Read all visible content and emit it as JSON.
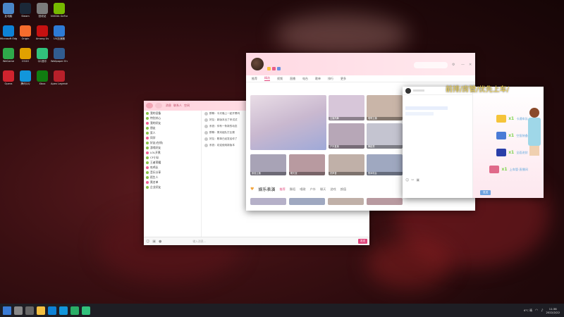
{
  "desktop": {
    "icons": [
      {
        "label": "此电脑",
        "color": "#4a86c8"
      },
      {
        "label": "Steam",
        "color": "#1b2838"
      },
      {
        "label": "回收站",
        "color": "#7b7b7b"
      },
      {
        "label": "NVIDIA GeForce",
        "color": "#76b900"
      },
      {
        "label": "Microsoft Edge",
        "color": "#0d82d6"
      },
      {
        "label": "Origin",
        "color": "#f56c2d"
      },
      {
        "label": "Among Us",
        "color": "#c51111"
      },
      {
        "label": "UU加速器",
        "color": "#2e7bd6"
      },
      {
        "label": "WeGame",
        "color": "#2fa94a"
      },
      {
        "label": "CSGO",
        "color": "#e0a100"
      },
      {
        "label": "QQ音乐",
        "color": "#31c27c"
      },
      {
        "label": "Wallpaper Engine",
        "color": "#315c90"
      },
      {
        "label": "Opera",
        "color": "#d0232e"
      },
      {
        "label": "腾讯QQ",
        "color": "#1296db"
      },
      {
        "label": "Xbox",
        "color": "#107c10"
      },
      {
        "label": "Apex Legends",
        "color": "#b8202a"
      }
    ]
  },
  "qq_window": {
    "title_tabs": [
      "消息",
      "联系人",
      "空间"
    ],
    "groups": [
      "我的设备",
      "特别关心",
      "我的好友",
      "朋友",
      "家人",
      "同学",
      "好友(在线)",
      "游戏好友",
      "LOL开黑",
      "CF小队",
      "王者荣耀",
      "吃鸡队",
      "音乐分享",
      "陌生人",
      "黑名单",
      "企业好友"
    ],
    "messages": [
      "群聊：今天晚上一起开黑吗",
      "好友：新版本出了来试试",
      "系统：你有一条新的动态",
      "群聊：周末组队打比赛",
      "好友：歌单已经发给你了",
      "系统：欢迎使用新版本"
    ],
    "input_placeholder": "输入消息...",
    "send_label": "发送"
  },
  "music_window": {
    "tabs": [
      "推荐",
      "精选",
      "视频",
      "直播",
      "电台",
      "歌单",
      "排行",
      "更多"
    ],
    "active_tab": 1,
    "section_title": "娱乐表演",
    "section_tags": [
      "推荐",
      "舞蹈",
      "唱歌",
      "户外",
      "聊天",
      "游戏",
      "颜值"
    ],
    "cards": [
      "主播热舞",
      "唱歌主播",
      "户外直播",
      "舞蹈秀",
      "颜值主播",
      "聊天室",
      "好声音",
      "夜间电台",
      "才艺展示",
      "游戏实况"
    ]
  },
  "game_chat": {
    "overlay_text": "前排/房管/优先上车/",
    "rewards": [
      {
        "label": "卡通车队",
        "color": "#f5c43a"
      },
      {
        "label": "空投装备",
        "color": "#4a7bd6"
      },
      {
        "label": "全面进阶",
        "color": "#2a3fa8"
      },
      {
        "label": "上车管·直播间",
        "color": "#e06a8a"
      }
    ],
    "multiplier": "x1",
    "send_label": "发送"
  },
  "taskbar": {
    "icons": [
      "start",
      "search",
      "taskview",
      "explorer",
      "edge",
      "qq",
      "wechat",
      "music"
    ],
    "weather": "6°C 晴",
    "time": "11:38",
    "date": "2022/2/22"
  }
}
